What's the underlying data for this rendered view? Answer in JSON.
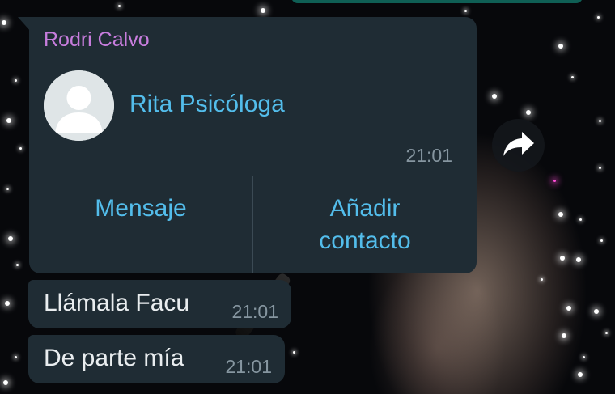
{
  "chat": {
    "contact_card": {
      "sender": "Rodri Calvo",
      "contact_name": "Rita Psicóloga",
      "time": "21:01",
      "actions": {
        "message": "Mensaje",
        "add_contact": "Añadir contacto"
      }
    },
    "messages": [
      {
        "text": "Llámala Facu",
        "time": "21:01"
      },
      {
        "text": "De parte mía",
        "time": "21:01"
      }
    ]
  },
  "icons": {
    "forward": "forward-icon",
    "avatar": "default-avatar-icon"
  },
  "colors": {
    "bubble": "#1f2c34",
    "sender_name": "#c77ddd",
    "link_blue": "#53bdeb",
    "timestamp": "#8696a0",
    "text": "#e9edef"
  }
}
